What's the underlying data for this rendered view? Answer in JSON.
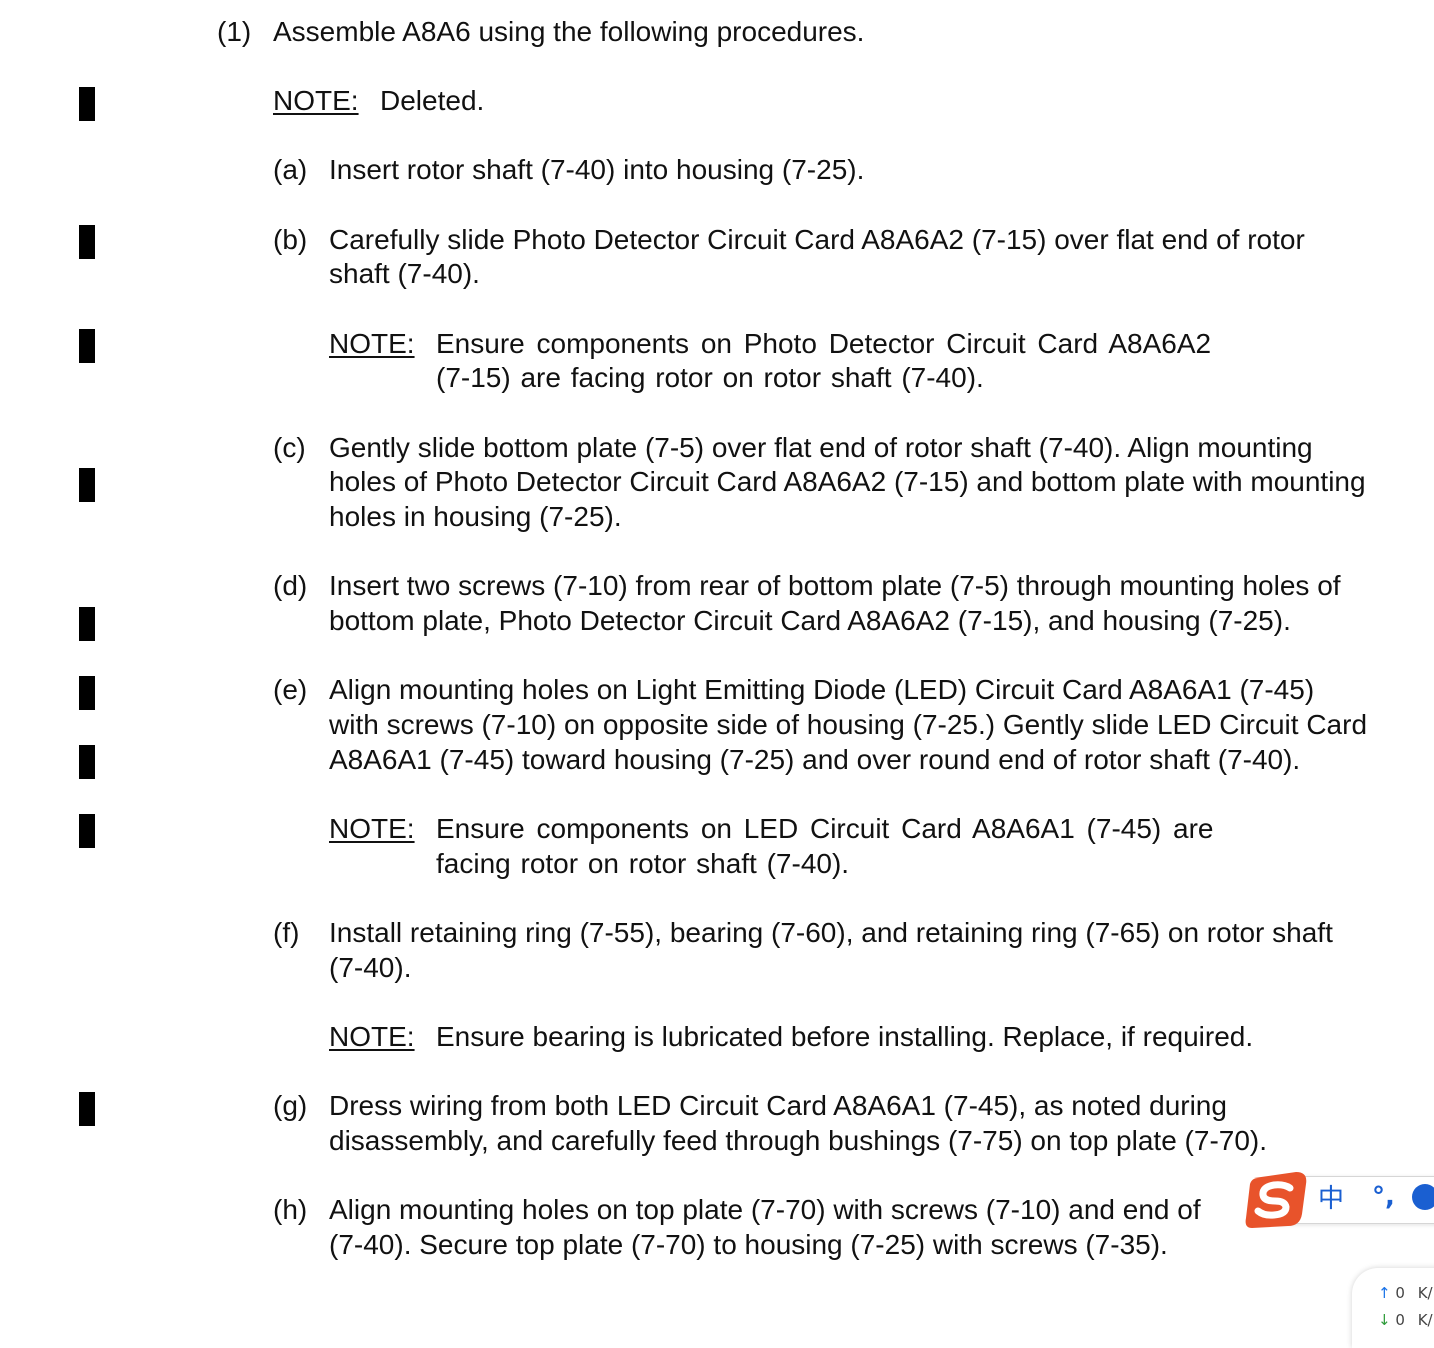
{
  "document": {
    "step_heading": {
      "number": "(1)",
      "text": "Assemble A8A6 using the following procedures."
    },
    "note_1": {
      "label": "NOTE:",
      "text": "Deleted."
    },
    "steps": {
      "a": {
        "label": "(a)",
        "lines": [
          "Insert rotor shaft (7-40) into housing (7-25)."
        ]
      },
      "b": {
        "label": "(b)",
        "lines": [
          "Carefully slide Photo Detector Circuit Card A8A6A2 (7-15) over flat end of rotor",
          "shaft (7-40)."
        ]
      },
      "c": {
        "label": "(c)",
        "lines": [
          "Gently slide bottom plate (7-5) over flat end of rotor shaft (7-40).  Align mounting",
          "holes of Photo Detector Circuit Card A8A6A2 (7-15) and bottom plate with mounting",
          "holes in housing (7-25)."
        ]
      },
      "d": {
        "label": "(d)",
        "lines": [
          "Insert two screws (7-10) from rear of bottom plate (7-5) through mounting holes of",
          "bottom plate, Photo Detector Circuit Card A8A6A2 (7-15), and housing (7-25)."
        ]
      },
      "e": {
        "label": "(e)",
        "lines": [
          "Align mounting holes on Light Emitting Diode (LED) Circuit Card A8A6A1 (7-45)",
          "with screws (7-10) on opposite side of housing (7-25.) Gently slide LED Circuit Card",
          "A8A6A1 (7-45) toward housing (7-25) and over round end of rotor shaft (7-40)."
        ]
      },
      "f": {
        "label": "(f)",
        "lines": [
          "Install retaining ring (7-55), bearing (7-60), and retaining ring (7-65) on rotor shaft",
          "(7-40)."
        ]
      },
      "g": {
        "label": "(g)",
        "lines": [
          "Dress wiring from both LED Circuit Card A8A6A1 (7-45), as noted during",
          "disassembly, and carefully feed through bushings (7-75) on top plate (7-70)."
        ]
      },
      "h": {
        "label": "(h)",
        "lines": [
          "Align mounting holes on top plate (7-70) with screws (7-10) and end of",
          "(7-40).  Secure top plate (7-70) to housing (7-25) with screws (7-35)."
        ]
      }
    },
    "note_b": {
      "label": "NOTE:",
      "lines": [
        "Ensure components on Photo Detector Circuit Card A8A6A2",
        "(7-15) are facing rotor on rotor shaft (7-40)."
      ]
    },
    "note_e": {
      "label": "NOTE:",
      "lines": [
        "Ensure components on LED Circuit Card A8A6A1 (7-45) are",
        "facing rotor on rotor shaft (7-40)."
      ]
    },
    "note_f": {
      "label": "NOTE:",
      "text": "Ensure bearing is lubricated before installing.  Replace, if required."
    }
  },
  "ime_toolbar": {
    "logo_icon": "sogou-s-icon",
    "mode_label": "中",
    "punct_label": "°,",
    "logo_color": "#e8532b",
    "accent_color": "#1a5fd1"
  },
  "net_widget": {
    "upload": "0",
    "download": "0",
    "unit": "K/"
  }
}
